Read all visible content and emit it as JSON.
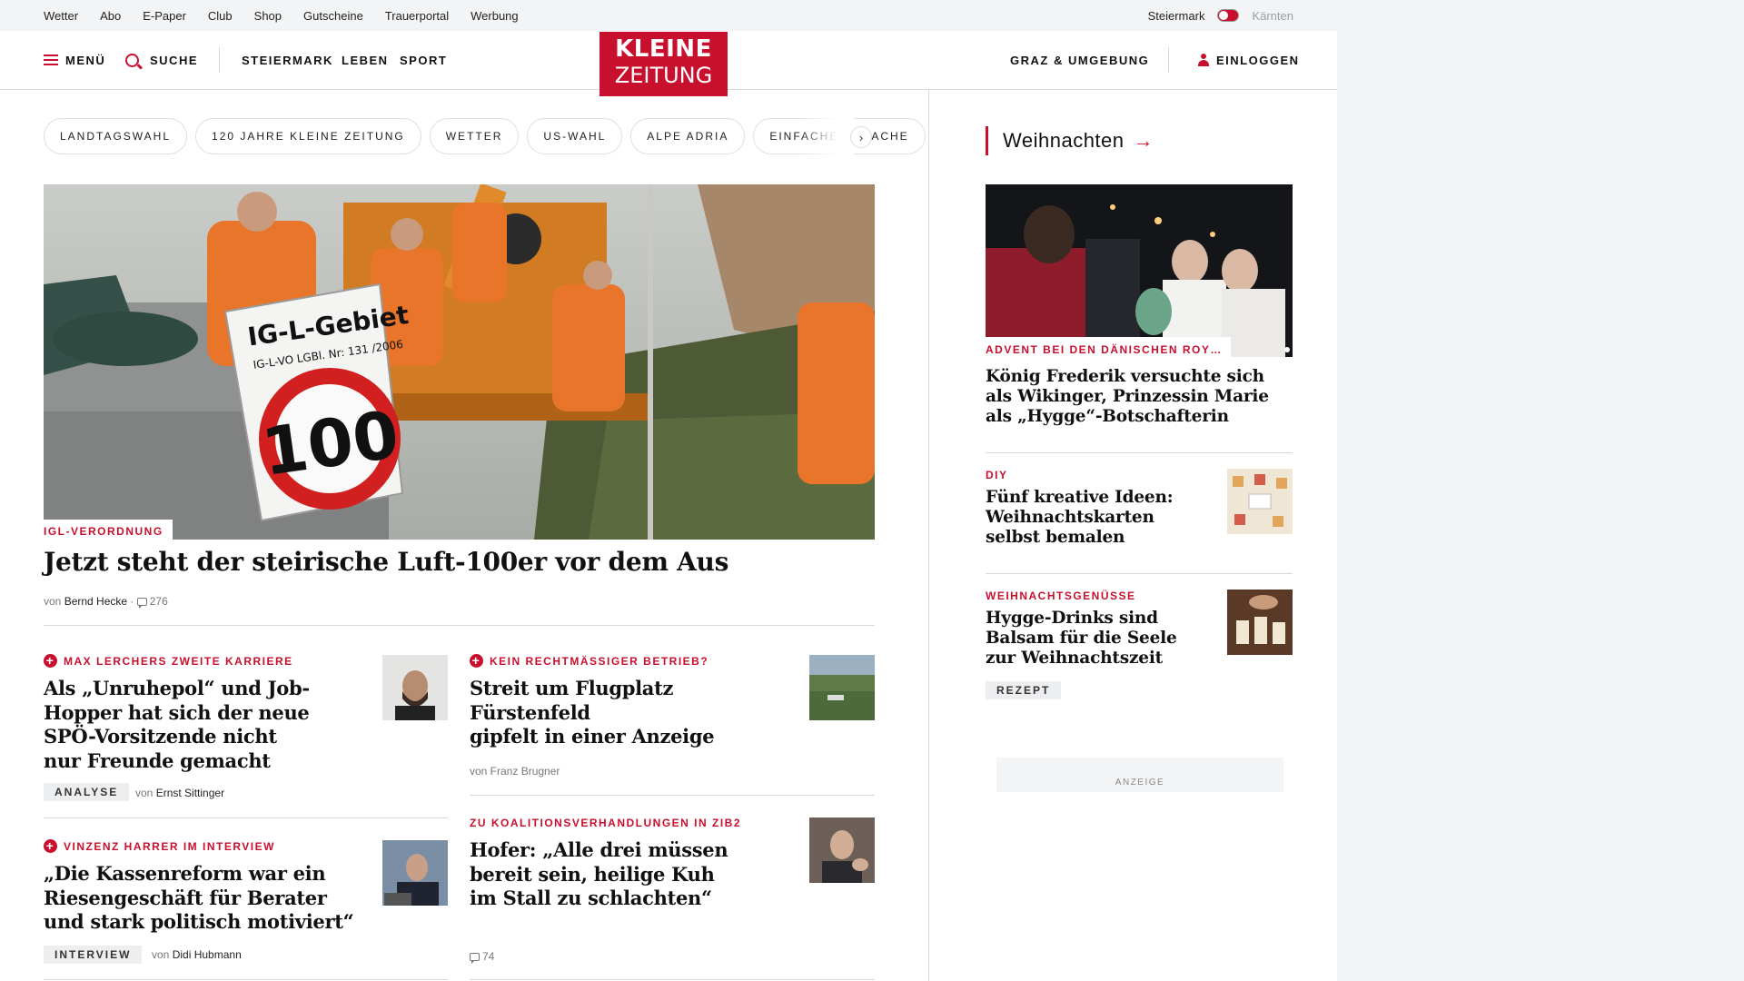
{
  "utility_bar": {
    "links": [
      "Wetter",
      "Abo",
      "E-Paper",
      "Club",
      "Shop",
      "Gutscheine",
      "Trauerportal",
      "Werbung"
    ],
    "region_active": "Steiermark",
    "region_inactive": "Kärnten"
  },
  "header": {
    "menu_label": "MENÜ",
    "search_label": "SUCHE",
    "nav": [
      "STEIERMARK",
      "LEBEN",
      "SPORT"
    ],
    "logo_line1": "KLEINE",
    "logo_line2": "ZEITUNG",
    "region_link": "GRAZ & UMGEBUNG",
    "login_label": "EINLOGGEN"
  },
  "chips": [
    "LANDTAGSWAHL",
    "120 JAHRE KLEINE ZEITUNG",
    "WETTER",
    "US-WAHL",
    "ALPE ADRIA",
    "EINFACHE SPRACHE"
  ],
  "hero": {
    "sign_line1": "IG-L-Gebiet",
    "sign_line2": "IG-L-VO LGBl. Nr: 131 /2006",
    "sign_speed": "100",
    "kicker": "IGL-VERORDNUNG",
    "title": "Jetzt steht der steirische Luft-100er vor dem Aus",
    "byline_prefix": "von",
    "author": "Bernd Hecke",
    "comments": "276"
  },
  "teasers": [
    {
      "kicker": "MAX LERCHERS ZWEITE KARRIERE",
      "title_lines": [
        "Als „Unruhepol“ und Job-",
        "Hopper hat sich der neue",
        "SPÖ-Vorsitzende nicht",
        "nur Freunde gemacht"
      ],
      "tag": "ANALYSE",
      "byline_prefix": "von",
      "author": "Ernst Sittinger"
    },
    {
      "kicker": "KEIN RECHTMÄSSIGER BETRIEB?",
      "title_lines": [
        "Streit um Flugplatz Fürstenfeld",
        "gipfelt in einer Anzeige"
      ],
      "byline": "von Franz Brugner"
    },
    {
      "kicker": "VINZENZ HARRER IM INTERVIEW",
      "title_lines": [
        "„Die Kassenreform war ein",
        "Riesengeschäft für Berater",
        "und stark politisch motiviert“"
      ],
      "tag": "INTERVIEW",
      "byline_prefix": "von",
      "author": "Didi Hubmann"
    },
    {
      "kicker": "ZU KOALITIONSVERHANDLUNGEN IN ZIB2",
      "title_lines": [
        "Hofer: „Alle drei müssen",
        "bereit sein, heilige Kuh",
        "im Stall zu schlachten“"
      ],
      "comments": "74"
    }
  ],
  "sidebar": {
    "section_title": "Weihnachten",
    "lead": {
      "kicker": "ADVENT BEI DEN DÄNISCHEN ROY…",
      "title_lines": [
        "König Frederik versuchte sich",
        "als Wikinger, Prinzessin Marie",
        "als „Hygge“-Botschafterin"
      ]
    },
    "items": [
      {
        "kicker": "DIY",
        "title_lines": [
          "Fünf kreative Ideen:",
          "Weihnachtskarten",
          "selbst bemalen"
        ]
      },
      {
        "kicker": "WEIHNACHTSGENÜSSE",
        "title_lines": [
          "Hygge-Drinks sind",
          "Balsam für die Seele",
          "zur Weihnachtszeit"
        ],
        "tag": "REZEPT"
      }
    ],
    "ad_label": "ANZEIGE"
  },
  "colors": {
    "brand_red": "#c8102e",
    "divider": "#d9d9d9",
    "tag_bg": "#eceef0"
  }
}
